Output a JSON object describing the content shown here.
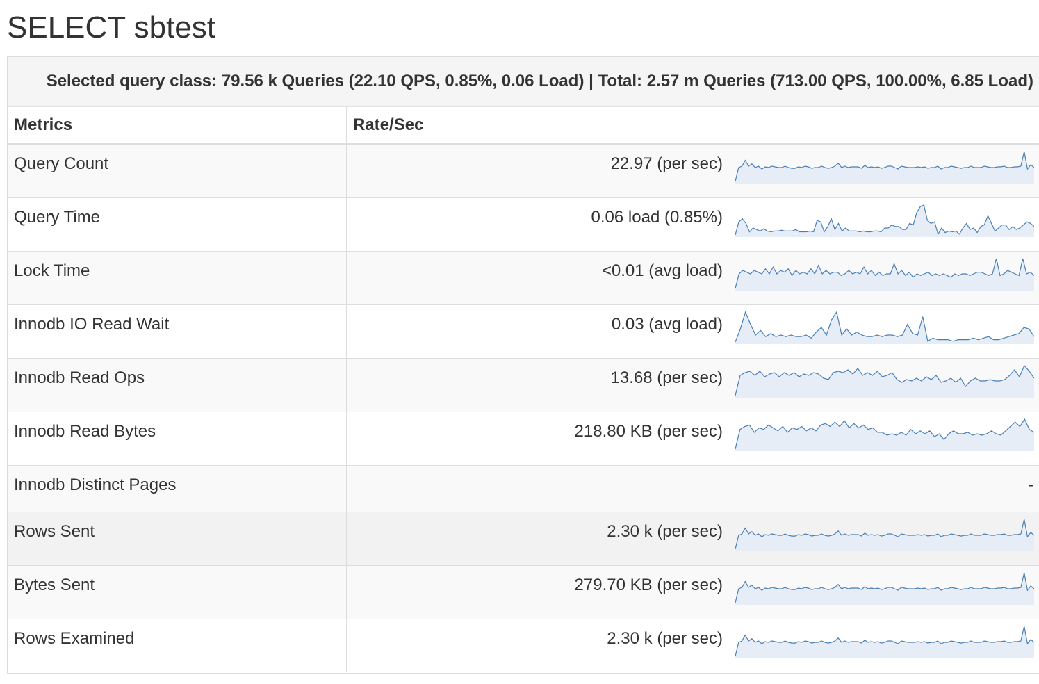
{
  "title": "SELECT sbtest",
  "summary": "Selected query class: 79.56 k Queries (22.10 QPS, 0.85%, 0.06 Load) | Total: 2.57 m Queries (713.00 QPS, 100.00%, 6.85 Load)",
  "table": {
    "headers": [
      "Metrics",
      "Rate/Sec"
    ],
    "rows": [
      {
        "metric": "Query Count",
        "value": "22.97 (per sec)",
        "spark": [
          1,
          20,
          22,
          30,
          22,
          25,
          20,
          22,
          18,
          21,
          20,
          22,
          21,
          20,
          20,
          22,
          20,
          19,
          19,
          21,
          20,
          22,
          21,
          19,
          20,
          20,
          22,
          20,
          19,
          20,
          22,
          26,
          20,
          22,
          20,
          21,
          21,
          21,
          19,
          23,
          20,
          21,
          20,
          21,
          19,
          20,
          22,
          22,
          20,
          18,
          22,
          21,
          20,
          20,
          20,
          21,
          20,
          21,
          19,
          20,
          20,
          22,
          18,
          20,
          20,
          22,
          21,
          20,
          19,
          20,
          20,
          22,
          20,
          20,
          20,
          22,
          21,
          20,
          20,
          21,
          21,
          22,
          20,
          20,
          21,
          21,
          22,
          42,
          18,
          24,
          20
        ]
      },
      {
        "metric": "Query Time",
        "value": "0.06 load (0.85%)",
        "spark": [
          1,
          18,
          22,
          16,
          5,
          10,
          8,
          6,
          9,
          6,
          5,
          6,
          6,
          7,
          6,
          6,
          6,
          8,
          5,
          5,
          5,
          6,
          5,
          20,
          18,
          5,
          12,
          22,
          8,
          16,
          6,
          10,
          6,
          6,
          6,
          5,
          6,
          5,
          5,
          6,
          6,
          5,
          10,
          10,
          14,
          12,
          12,
          8,
          8,
          16,
          14,
          30,
          38,
          40,
          20,
          16,
          18,
          2,
          10,
          4,
          6,
          5,
          6,
          2,
          10,
          16,
          8,
          10,
          4,
          12,
          14,
          26,
          16,
          6,
          10,
          14,
          14,
          8,
          12,
          8,
          10,
          14,
          18,
          16,
          12
        ]
      },
      {
        "metric": "Lock Time",
        "value": "<0.01 (avg load)",
        "spark": [
          1,
          18,
          22,
          20,
          18,
          22,
          20,
          18,
          24,
          18,
          26,
          18,
          22,
          20,
          24,
          16,
          22,
          18,
          20,
          18,
          24,
          18,
          28,
          18,
          22,
          18,
          20,
          20,
          16,
          18,
          22,
          18,
          20,
          18,
          26,
          18,
          22,
          16,
          20,
          16,
          18,
          18,
          30,
          18,
          22,
          16,
          20,
          14,
          18,
          16,
          18,
          20,
          16,
          18,
          16,
          18,
          16,
          14,
          18,
          16,
          18,
          18,
          16,
          18,
          20,
          20,
          18,
          16,
          18,
          36,
          16,
          18,
          22,
          20,
          18,
          16,
          36,
          18,
          20,
          16
        ]
      },
      {
        "metric": "Innodb IO Read Wait",
        "value": "0.03 (avg load)",
        "spark": [
          1,
          18,
          40,
          24,
          10,
          16,
          8,
          12,
          8,
          10,
          8,
          10,
          8,
          8,
          10,
          6,
          14,
          20,
          10,
          30,
          40,
          10,
          18,
          10,
          14,
          10,
          8,
          8,
          10,
          8,
          10,
          10,
          8,
          10,
          24,
          12,
          10,
          34,
          2,
          6,
          4,
          4,
          4,
          2,
          4,
          4,
          4,
          6,
          4,
          6,
          8,
          4,
          4,
          6,
          8,
          10,
          12,
          20,
          18,
          8
        ]
      },
      {
        "metric": "Innodb Read Ops",
        "value": "13.68 (per sec)",
        "spark": [
          1,
          30,
          34,
          36,
          30,
          36,
          28,
          32,
          34,
          28,
          34,
          30,
          34,
          28,
          32,
          30,
          34,
          32,
          26,
          24,
          34,
          36,
          34,
          38,
          32,
          40,
          30,
          34,
          30,
          36,
          28,
          30,
          34,
          24,
          20,
          24,
          22,
          26,
          22,
          28,
          24,
          30,
          20,
          22,
          26,
          20,
          26,
          14,
          22,
          26,
          22,
          22,
          24,
          22,
          22,
          24,
          30,
          38,
          28,
          44,
          36,
          26
        ]
      },
      {
        "metric": "Innodb Read Bytes",
        "value": "218.80 KB (per sec)",
        "spark": [
          1,
          28,
          32,
          34,
          24,
          30,
          28,
          34,
          30,
          26,
          32,
          24,
          30,
          28,
          32,
          26,
          30,
          26,
          34,
          36,
          32,
          38,
          32,
          40,
          30,
          36,
          30,
          34,
          28,
          30,
          24,
          24,
          20,
          22,
          20,
          24,
          20,
          28,
          22,
          26,
          22,
          26,
          18,
          22,
          14,
          22,
          26,
          22,
          22,
          24,
          20,
          22,
          20,
          22,
          26,
          22,
          20,
          26,
          32,
          38,
          32,
          42,
          28,
          24
        ]
      },
      {
        "metric": "Innodb Distinct Pages",
        "value": "-",
        "spark": []
      },
      {
        "metric": "Rows Sent",
        "value": "2.30 k (per sec)",
        "spark": [
          1,
          20,
          22,
          30,
          22,
          25,
          20,
          22,
          18,
          21,
          20,
          22,
          21,
          20,
          20,
          22,
          20,
          19,
          19,
          21,
          20,
          22,
          21,
          19,
          20,
          20,
          22,
          20,
          19,
          20,
          22,
          26,
          20,
          22,
          20,
          21,
          21,
          21,
          19,
          23,
          20,
          21,
          20,
          21,
          19,
          20,
          22,
          22,
          20,
          18,
          22,
          21,
          20,
          20,
          20,
          21,
          20,
          21,
          19,
          20,
          20,
          22,
          18,
          20,
          20,
          22,
          21,
          20,
          19,
          20,
          20,
          22,
          20,
          20,
          20,
          22,
          21,
          20,
          20,
          21,
          21,
          22,
          20,
          20,
          21,
          21,
          22,
          42,
          18,
          24,
          20
        ]
      },
      {
        "metric": "Bytes Sent",
        "value": "279.70 KB (per sec)",
        "spark": [
          1,
          20,
          22,
          30,
          22,
          25,
          20,
          22,
          18,
          21,
          20,
          22,
          21,
          20,
          20,
          22,
          20,
          19,
          19,
          21,
          20,
          22,
          21,
          19,
          20,
          20,
          22,
          20,
          19,
          20,
          22,
          26,
          20,
          22,
          20,
          21,
          21,
          21,
          19,
          23,
          20,
          21,
          20,
          21,
          19,
          20,
          22,
          22,
          20,
          18,
          22,
          21,
          20,
          20,
          20,
          21,
          20,
          21,
          19,
          20,
          20,
          22,
          18,
          20,
          20,
          22,
          21,
          20,
          19,
          20,
          20,
          22,
          20,
          20,
          20,
          22,
          21,
          20,
          20,
          21,
          21,
          22,
          20,
          20,
          21,
          21,
          22,
          42,
          18,
          24,
          20
        ]
      },
      {
        "metric": "Rows Examined",
        "value": "2.30 k (per sec)",
        "spark": [
          1,
          20,
          22,
          30,
          22,
          25,
          20,
          22,
          18,
          21,
          20,
          22,
          21,
          20,
          20,
          22,
          20,
          19,
          19,
          21,
          20,
          22,
          21,
          19,
          20,
          20,
          22,
          20,
          19,
          20,
          22,
          26,
          20,
          22,
          20,
          21,
          21,
          21,
          19,
          23,
          20,
          21,
          20,
          21,
          19,
          20,
          22,
          22,
          20,
          18,
          22,
          21,
          20,
          20,
          20,
          21,
          20,
          21,
          19,
          20,
          20,
          22,
          18,
          20,
          20,
          22,
          21,
          20,
          19,
          20,
          20,
          22,
          20,
          20,
          20,
          22,
          21,
          20,
          20,
          21,
          21,
          22,
          20,
          20,
          21,
          21,
          22,
          42,
          18,
          24,
          20
        ]
      }
    ]
  },
  "colors": {
    "spark_line": "#4a7fb5",
    "spark_fill": "#e6edf7"
  }
}
